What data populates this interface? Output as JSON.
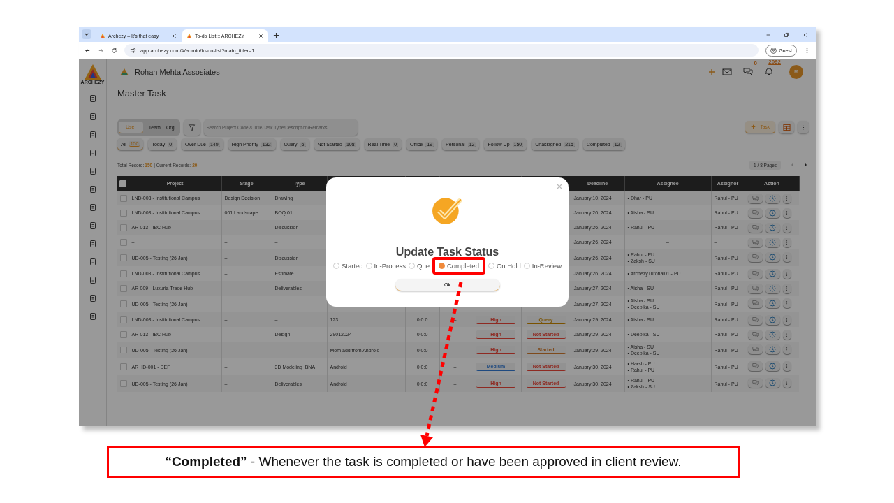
{
  "browser": {
    "tabs": [
      {
        "title": "Archezy – It's that easy",
        "selected": false
      },
      {
        "title": "To-do List :: ARCHEZY",
        "selected": true
      }
    ],
    "url": "app.archezy.com/#/admin/to-do-list?main_filter=1",
    "profile": "Guest"
  },
  "app": {
    "logo_text": "ARCHEZY",
    "company": "Rohan Mehta Assosiates",
    "chat_count": "0",
    "notification_count": "2092",
    "avatar": "R",
    "heading": "Master Task",
    "scope": [
      {
        "label": "User",
        "selected": true
      },
      {
        "label": "Team",
        "selected": false
      },
      {
        "label": "Org.",
        "selected": false
      }
    ],
    "search": {
      "placeholder": "Search Project Code & Title/Task Type/Description/Remarks"
    },
    "add_button": "Task",
    "filters": [
      {
        "label": "All",
        "count": "150",
        "selected": true
      },
      {
        "label": "Today",
        "count": "0",
        "selected": false
      },
      {
        "label": "Over Due",
        "count": "149",
        "selected": false
      },
      {
        "label": "High Priority",
        "count": "132",
        "selected": false
      },
      {
        "label": "Query",
        "count": "6",
        "selected": false
      },
      {
        "label": "Not Started",
        "count": "108",
        "selected": false
      },
      {
        "label": "Real Time",
        "count": "0",
        "selected": false
      },
      {
        "label": "Office",
        "count": "19",
        "selected": false
      },
      {
        "label": "Personal",
        "count": "12",
        "selected": false
      },
      {
        "label": "Follow Up",
        "count": "150",
        "selected": false
      },
      {
        "label": "Unassigned",
        "count": "215",
        "selected": false
      },
      {
        "label": "Completed",
        "count": "12",
        "selected": false
      }
    ],
    "summary": {
      "total_label": "Total Record:",
      "total": "150",
      "current_label": "| Current Records:",
      "current": "20"
    },
    "pages": "1 / 8 Pages",
    "table": {
      "header_checked": false,
      "columns": [
        "Project",
        "Stage",
        "Type",
        "Deadline",
        "Assignee",
        "Assignor",
        "Action"
      ],
      "rows": [
        {
          "checked": false,
          "project": "LND-003 - Institutional Campus",
          "stage": "Design Decision",
          "type": "Drawing",
          "deadline": "January 10, 2024",
          "assignees": [
            "• Dhar - PU"
          ],
          "assignor": "Rahul - PU"
        },
        {
          "checked": false,
          "project": "LND-003 - Institutional Campus",
          "stage": "001 Landscape",
          "type": "BOQ 01",
          "deadline": "January 20, 2024",
          "assignees": [
            "• Aisha - SU"
          ],
          "assignor": "Rahul - PU"
        },
        {
          "checked": false,
          "project": "AR-013 - IBC Hub",
          "stage": "–",
          "type": "Discussion",
          "deadline": "January 26, 2024",
          "assignees": [
            "• Rahul - PU"
          ],
          "assignor": "Rahul - PU"
        },
        {
          "checked": false,
          "project": "–",
          "stage": "–",
          "type": "–",
          "deadline": "January 26, 2024",
          "assignee": "–",
          "assignor": "–"
        },
        {
          "checked": false,
          "project": "UD-005 - Testing (26 Jan)",
          "stage": "–",
          "type": "Discussion",
          "deadline": "January 26, 2024",
          "assignees": [
            "• Rahul - PU",
            "• Zaksh - SU"
          ],
          "assignor": "Rahul - PU"
        },
        {
          "checked": false,
          "project": "LND-003 - Institutional Campus",
          "stage": "–",
          "type": "Estimate",
          "deadline": "January 26, 2024",
          "assignees": [
            "• ArchezyTutorial01 - PU"
          ],
          "assignor": "Rahul - PU"
        },
        {
          "checked": false,
          "project": "AR-009 - Luxuria Trade Hub",
          "stage": "–",
          "type": "Deliverables",
          "deadline": "January 27, 2024",
          "assignees": [
            "• Aisha - SU"
          ],
          "assignor": "Rahul - PU"
        },
        {
          "checked": false,
          "project": "UD-005 - Testing (26 Jan)",
          "stage": "–",
          "type": "–",
          "deadline": "January 27, 2024",
          "assignees": [
            "• Aisha - SU",
            "• Deepika - SU"
          ],
          "assignor": "Rahul - PU"
        },
        {
          "checked": false,
          "project": "LND-003 - Institutional Campus",
          "stage": "–",
          "type": "–",
          "title": "123",
          "time": "0:0:0",
          "column_7": "–",
          "priority": {
            "label": "High",
            "color": "#8e2a22"
          },
          "status": {
            "label": "Query",
            "color": "#7a5200"
          },
          "deadline": "January 29, 2024",
          "assignees": [
            "• Aisha - SU"
          ],
          "assignor": "Rahul - PU"
        },
        {
          "checked": false,
          "project": "AR-013 - IBC Hub",
          "stage": "–",
          "type": "Design",
          "title": "29012024",
          "time": "0:0:0",
          "column_7": "–",
          "priority": {
            "label": "High",
            "color": "#8e2a22"
          },
          "status": {
            "label": "Not Started",
            "color": "#8e2a22"
          },
          "deadline": "January 29, 2024",
          "assignees": [
            "• Deepika - SU"
          ],
          "assignor": "Rahul - PU"
        },
        {
          "checked": false,
          "project": "UD-005 - Testing (26 Jan)",
          "stage": "–",
          "type": "–",
          "title": "Mom add from Android",
          "time": "0:0:0",
          "column_7": "–",
          "priority": {
            "label": "High",
            "color": "#8e2a22"
          },
          "status": {
            "label": "Started",
            "color": "#7e4a1c"
          },
          "deadline": "January 29, 2024",
          "assignees": [
            "• Aisha - SU",
            "• Deepika - SU"
          ],
          "assignor": "Rahul - PU"
        },
        {
          "checked": false,
          "project": "AR+ID-001 - DEF",
          "stage": "–",
          "type": "3D Modeling_BNA",
          "title": "Android",
          "time": "0:0:0",
          "column_7": "–",
          "priority": {
            "label": "Medium",
            "color": "#1f4a80"
          },
          "status": {
            "label": "Not Started",
            "color": "#8e2a22"
          },
          "deadline": "January 30, 2024",
          "assignees": [
            "• Harsh - PU",
            "• Rahul - PU"
          ],
          "assignor": "Rahul - PU"
        },
        {
          "checked": false,
          "project": "UD-005 - Testing (26 Jan)",
          "stage": "–",
          "type": "Deliverables",
          "title": "Android",
          "time": "0:0:0",
          "column_7": "–",
          "priority": {
            "label": "High",
            "color": "#8e2a22"
          },
          "status": {
            "label": "Not Started",
            "color": "#8e2a22"
          },
          "deadline": "January 30, 2024",
          "assignees": [
            "• Rahul - PU",
            "• Zaksh - SU"
          ],
          "assignor": "Rahul - PU"
        }
      ]
    }
  },
  "modal": {
    "title": "Update Task Status",
    "options": [
      {
        "label": "Started",
        "selected": false
      },
      {
        "label": "In-Process",
        "selected": false
      },
      {
        "label": "Que",
        "selected": false
      },
      {
        "label": "Completed",
        "selected": true
      },
      {
        "label": "On Hold",
        "selected": false
      },
      {
        "label": "In-Review",
        "selected": false
      }
    ],
    "ok": "Ok"
  },
  "caption": "**“Completed”** - Whenever the task is completed or have been approved in client review."
}
